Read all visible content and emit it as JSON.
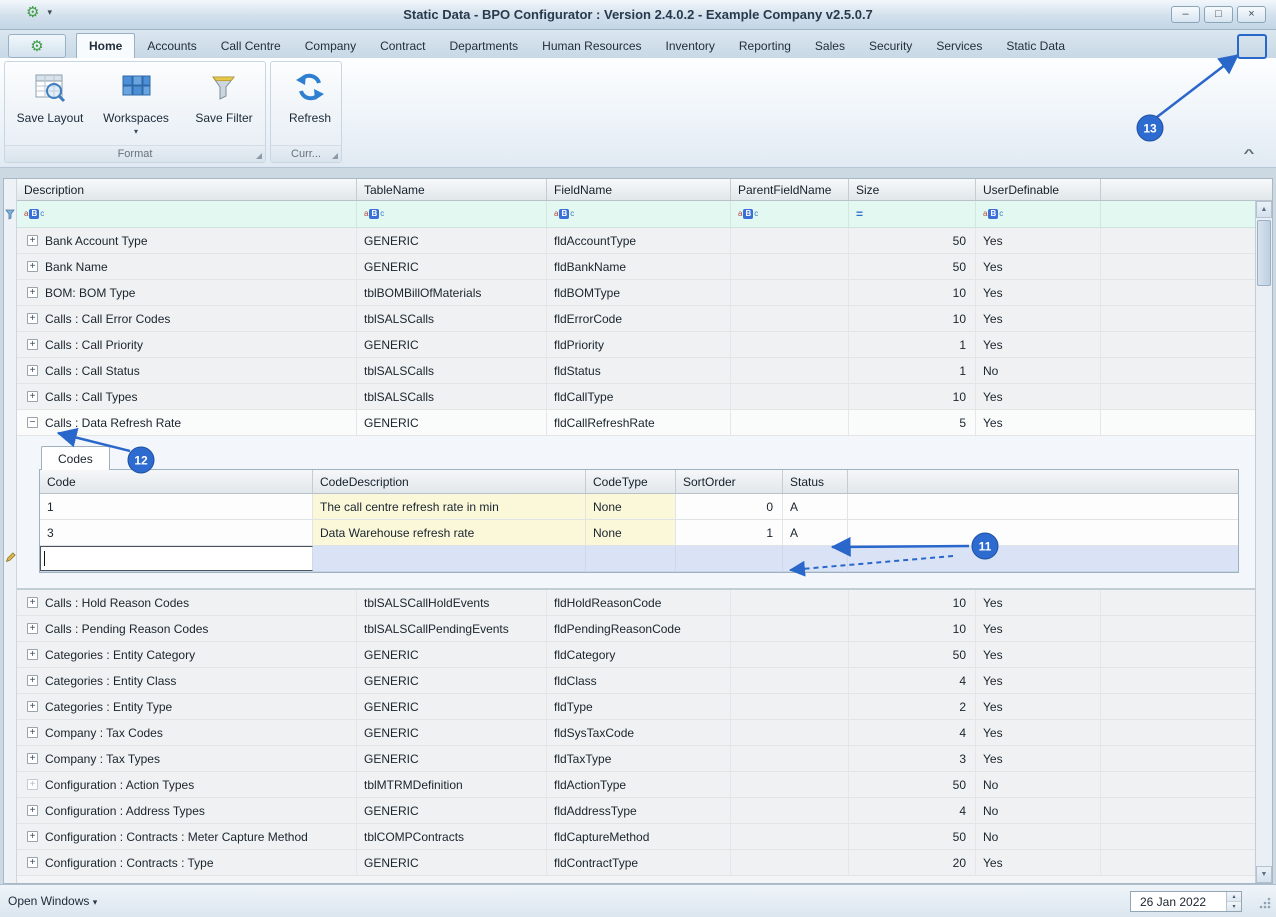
{
  "titlebar": {
    "title": "Static Data - BPO Configurator : Version 2.4.0.2 - Example Company v2.5.0.7"
  },
  "icons": {
    "app_gear": "⚙",
    "qat_dropdown": "▾",
    "minimize": "–",
    "maximize": "□",
    "close": "×",
    "ribbon_minimize": "–",
    "ribbon_close": "×",
    "chevron_up": "^",
    "scroll_up": "▲",
    "scroll_down": "▼",
    "spin_up": "▴",
    "spin_down": "▾",
    "dropdown_arrow": "▾",
    "text_filter": [
      "a",
      "B",
      "c"
    ],
    "numeric_filter": "=",
    "expand": "+",
    "collapse": "−"
  },
  "tabs": [
    "Home",
    "Accounts",
    "Call Centre",
    "Company",
    "Contract",
    "Departments",
    "Human Resources",
    "Inventory",
    "Reporting",
    "Sales",
    "Security",
    "Services",
    "Static Data"
  ],
  "active_tab": "Home",
  "ribbon": {
    "buttons": [
      {
        "label": "Save Layout"
      },
      {
        "label": "Workspaces"
      },
      {
        "label": "Save Filter"
      },
      {
        "label": "Refresh"
      }
    ],
    "groups": [
      {
        "label": "Format"
      },
      {
        "label": "Curr..."
      }
    ]
  },
  "grid": {
    "columns": [
      "Description",
      "TableName",
      "FieldName",
      "ParentFieldName",
      "Size",
      "UserDefinable"
    ],
    "rows": [
      {
        "desc": "Bank Account Type",
        "table": "GENERIC",
        "field": "fldAccountType",
        "parent": "",
        "size": "50",
        "ud": "Yes"
      },
      {
        "desc": "Bank Name",
        "table": "GENERIC",
        "field": "fldBankName",
        "parent": "",
        "size": "50",
        "ud": "Yes"
      },
      {
        "desc": "BOM: BOM Type",
        "table": "tblBOMBillOfMaterials",
        "field": "fldBOMType",
        "parent": "",
        "size": "10",
        "ud": "Yes"
      },
      {
        "desc": "Calls : Call Error Codes",
        "table": "tblSALSCalls",
        "field": "fldErrorCode",
        "parent": "",
        "size": "10",
        "ud": "Yes"
      },
      {
        "desc": "Calls : Call Priority",
        "table": "GENERIC",
        "field": "fldPriority",
        "parent": "",
        "size": "1",
        "ud": "Yes"
      },
      {
        "desc": "Calls : Call Status",
        "table": "tblSALSCalls",
        "field": "fldStatus",
        "parent": "",
        "size": "1",
        "ud": "No"
      },
      {
        "desc": "Calls : Call Types",
        "table": "tblSALSCalls",
        "field": "fldCallType",
        "parent": "",
        "size": "10",
        "ud": "Yes"
      },
      {
        "desc": "Calls : Data Refresh Rate",
        "table": "GENERIC",
        "field": "fldCallRefreshRate",
        "parent": "",
        "size": "5",
        "ud": "Yes",
        "expanded": true
      },
      {
        "desc": "Calls : Hold Reason Codes",
        "table": "tblSALSCallHoldEvents",
        "field": "fldHoldReasonCode",
        "parent": "",
        "size": "10",
        "ud": "Yes"
      },
      {
        "desc": "Calls : Pending Reason Codes",
        "table": "tblSALSCallPendingEvents",
        "field": "fldPendingReasonCode",
        "parent": "",
        "size": "10",
        "ud": "Yes"
      },
      {
        "desc": "Categories : Entity Category",
        "table": "GENERIC",
        "field": "fldCategory",
        "parent": "",
        "size": "50",
        "ud": "Yes"
      },
      {
        "desc": "Categories : Entity Class",
        "table": "GENERIC",
        "field": "fldClass",
        "parent": "",
        "size": "4",
        "ud": "Yes"
      },
      {
        "desc": "Categories : Entity Type",
        "table": "GENERIC",
        "field": "fldType",
        "parent": "",
        "size": "2",
        "ud": "Yes"
      },
      {
        "desc": "Company : Tax Codes",
        "table": "GENERIC",
        "field": "fldSysTaxCode",
        "parent": "",
        "size": "4",
        "ud": "Yes"
      },
      {
        "desc": "Company : Tax Types",
        "table": "GENERIC",
        "field": "fldTaxType",
        "parent": "",
        "size": "3",
        "ud": "Yes"
      },
      {
        "desc": "Configuration : Action Types",
        "table": "tblMTRMDefinition",
        "field": "fldActionType",
        "parent": "",
        "size": "50",
        "ud": "No",
        "dim": true
      },
      {
        "desc": "Configuration : Address Types",
        "table": "GENERIC",
        "field": "fldAddressType",
        "parent": "",
        "size": "4",
        "ud": "No"
      },
      {
        "desc": "Configuration : Contracts : Meter Capture Method",
        "table": "tblCOMPContracts",
        "field": "fldCaptureMethod",
        "parent": "",
        "size": "50",
        "ud": "No"
      },
      {
        "desc": "Configuration : Contracts : Type",
        "table": "GENERIC",
        "field": "fldContractType",
        "parent": "",
        "size": "20",
        "ud": "Yes"
      }
    ]
  },
  "detail": {
    "tab": "Codes",
    "columns": [
      "Code",
      "CodeDescription",
      "CodeType",
      "SortOrder",
      "Status"
    ],
    "rows": [
      {
        "code": "1",
        "description": "The call centre refresh rate in min",
        "type": "None",
        "sort": "0",
        "status": "A"
      },
      {
        "code": "3",
        "description": "Data Warehouse refresh rate",
        "type": "None",
        "sort": "1",
        "status": "A"
      }
    ],
    "new_row": {
      "code": "",
      "description": "",
      "type": "",
      "sort": "",
      "status": ""
    }
  },
  "statusbar": {
    "open_windows": "Open Windows",
    "date": "26 Jan 2022"
  },
  "annotations": {
    "labels": [
      "11",
      "12",
      "13"
    ],
    "color": "#2a67cb"
  }
}
